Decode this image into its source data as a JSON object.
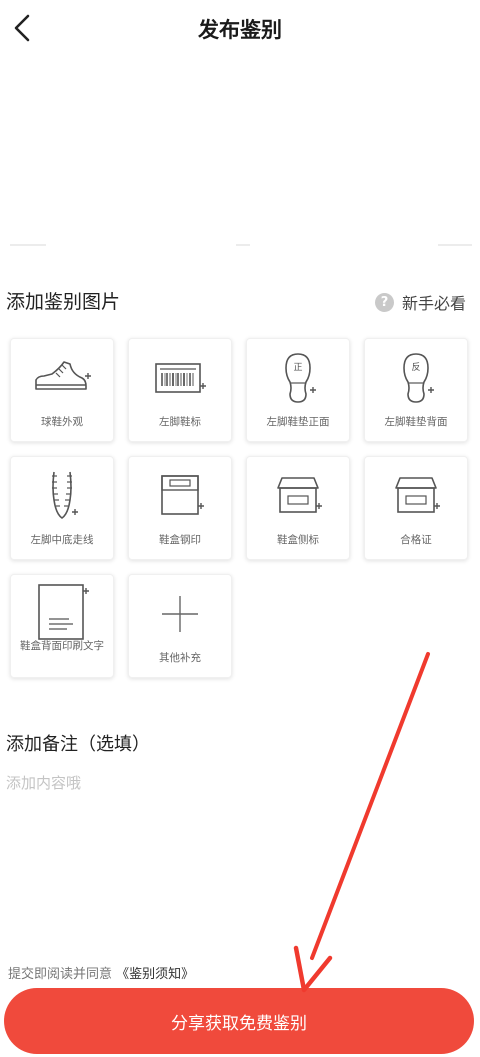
{
  "nav": {
    "title": "发布鉴别"
  },
  "upload": {
    "heading": "添加鉴别图片",
    "guide_label": "新手必看",
    "guide_icon_glyph": "?",
    "items": [
      {
        "label": "球鞋外观",
        "icon": "sneaker-icon"
      },
      {
        "label": "左脚鞋标",
        "icon": "barcode-label-icon"
      },
      {
        "label": "左脚鞋垫正面",
        "icon": "insole-front-icon",
        "glyph": "正"
      },
      {
        "label": "左脚鞋垫背面",
        "icon": "insole-back-icon",
        "glyph": "反"
      },
      {
        "label": "左脚中底走线",
        "icon": "midsole-stitch-icon"
      },
      {
        "label": "鞋盒钢印",
        "icon": "box-stamp-icon"
      },
      {
        "label": "鞋盒侧标",
        "icon": "box-side-label-icon"
      },
      {
        "label": "合格证",
        "icon": "certificate-icon"
      },
      {
        "label": "鞋盒背面印刷文字",
        "icon": "box-back-print-icon"
      },
      {
        "label": "其他补充",
        "icon": "plus-icon"
      }
    ]
  },
  "remark": {
    "heading": "添加备注（选填）",
    "placeholder": "添加内容哦"
  },
  "footer": {
    "agreement_text": "提交即阅读并同意",
    "agreement_link": "《鉴别须知》",
    "cta_label": "分享获取免费鉴别"
  },
  "colors": {
    "accent": "#f04a3c",
    "annotation_arrow": "#f03a2e",
    "icon_stroke": "#555555"
  }
}
